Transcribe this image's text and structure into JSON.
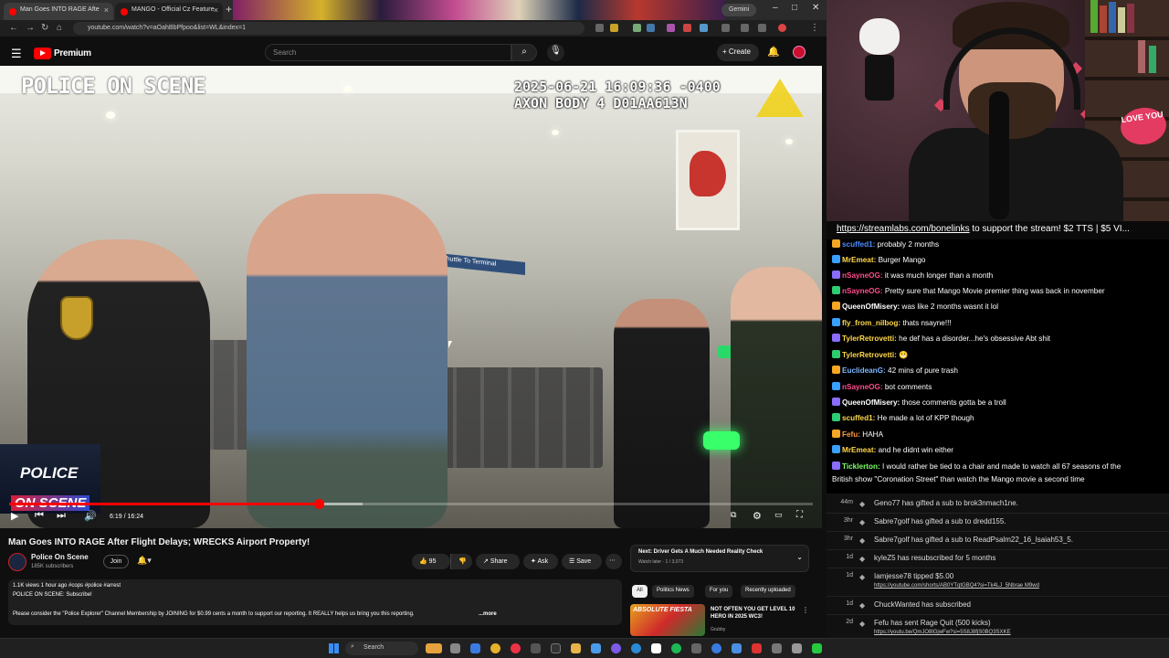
{
  "browser": {
    "tabs": [
      {
        "label": "Man Goes INTO RAGE Afte"
      },
      {
        "label": "MANGO - Official Cz Feature"
      }
    ],
    "gemini_label": "Gemini",
    "url": "youtube.com/watch?v=aOahBbPfpoo&list=WL&index=1"
  },
  "youtube": {
    "logo_text": "Premium",
    "search_placeholder": "Search",
    "create_label": "Create"
  },
  "video": {
    "overlay_title": "POLICE ON SCENE",
    "timestamp_line1": "2025-06-21 16:09:36 -0400",
    "timestamp_line2": "AXON BODY 4 D01AA613N",
    "sign_text": "Shuttle To Terminal",
    "brand_line1": "POLICE",
    "brand_line2": "ON SCENE",
    "time_display": "6:19 / 16:24",
    "progress_fraction": 0.385,
    "buffer_fraction": 0.44
  },
  "info": {
    "title": "Man Goes INTO RAGE After Flight Delays; WRECKS Airport Property!",
    "channel": "Police On Scene",
    "subscribers": "185K subscribers",
    "join_label": "Join",
    "like_count": "95",
    "share_label": "Share",
    "ask_label": "Ask",
    "save_label": "Save",
    "meta": "1.1K views  1 hour ago  #cops #police #arrest",
    "desc_line1": "POLICE ON SCENE: Subscribe!",
    "desc_line2": "Please consider the \"Police Explorer\" Channel Membership by JOINING for $0.99 cents a month to support our reporting. It REALLY helps us bring you this reporting.",
    "more_label": "...more"
  },
  "sidebar": {
    "next_title": "Next: Driver Gets A Much Needed Reality Check",
    "next_sub": "Watch later · 1 / 3,073",
    "chips": [
      "All",
      "Politics News",
      "For you",
      "Recently uploaded"
    ],
    "rec_thumb_text": "ABSOLUTE FIESTA",
    "rec_title": "NOT OFTEN YOU GET LEVEL 10 HERO IN 2025 WC3!",
    "rec_channel": "Grubby"
  },
  "taskbar": {
    "search_label": "Search"
  },
  "stream": {
    "love_sign": "LOVE YOU",
    "banner_link": "https://streamlabs.com/bonelinks",
    "banner_text": " to support the stream! $2 TTS | $5 VI..."
  },
  "chat": [
    {
      "user": "scuffed1:",
      "text": " probably 2 months",
      "color": "#4a8cff"
    },
    {
      "user": "MrEmeat:",
      "text": " Burger Mango",
      "color": "#ffd84a"
    },
    {
      "user": "nSayneOG:",
      "text": " it was much longer than a month",
      "color": "#ff4d8d"
    },
    {
      "user": "nSayneOG:",
      "text": " Pretty sure that Mango Movie premier thing was back in november",
      "color": "#ff4d8d"
    },
    {
      "user": "QueenOfMisery:",
      "text": " was like 2 months wasnt it lol",
      "color": "#ffffff"
    },
    {
      "user": "fly_from_nilbog:",
      "text": " thats nsayne!!!",
      "color": "#ffd84a"
    },
    {
      "user": "TylerRetrovetti:",
      "text": " he def has a disorder...he's obsessive Abt shit",
      "color": "#ffd84a"
    },
    {
      "user": "TylerRetrovetti:",
      "text": " 😬",
      "color": "#ffd84a"
    },
    {
      "user": "EuclideanG:",
      "text": " 42 mins of pure trash",
      "color": "#7fb6ff"
    },
    {
      "user": "nSayneOG:",
      "text": " bot comments",
      "color": "#ff4d8d"
    },
    {
      "user": "QueenOfMisery:",
      "text": " those comments gotta be a troll",
      "color": "#ffffff"
    },
    {
      "user": "scuffed1:",
      "text": " He made a lot of KPP though",
      "color": "#ffd84a"
    },
    {
      "user": "Fefu:",
      "text": " HAHA",
      "color": "#ff9c3d"
    },
    {
      "user": "MrEmeat:",
      "text": " and he didnt win either",
      "color": "#ffd84a"
    },
    {
      "user": "Ticklerton:",
      "text": " I would rather be tied to a chair and made to watch all 67 seasons of the",
      "color": "#7fff6a"
    },
    {
      "user": "",
      "text": "British show \"Coronation Street\" than watch the Mango movie a second time",
      "color": "#ffffff"
    }
  ],
  "events": [
    {
      "time": "44m",
      "text": "Geno77 has gifted a sub to brok3nmach1ne.",
      "sub": ""
    },
    {
      "time": "3hr",
      "text": "Sabre7golf has gifted a sub to dredd155.",
      "sub": ""
    },
    {
      "time": "3hr",
      "text": "Sabre7golf has gifted a sub to ReadPsalm22_16_Isaiah53_5.",
      "sub": ""
    },
    {
      "time": "1d",
      "text": "kyleZ5 has resubscribed for 5 months",
      "sub": ""
    },
    {
      "time": "1d",
      "text": "Iamjesse78 tipped $5.00",
      "sub": "https://youtube.com/shorts/AB0YTqtGBQ4?si=Tk4LJ_5Nbrae M9wd"
    },
    {
      "time": "1d",
      "text": "ChuckWanted has subscribed",
      "sub": ""
    },
    {
      "time": "2d",
      "text": "Fefu has sent Rage Quit (500 kicks)",
      "sub": "https://youtu.be/QmJO8lGjwFw?si=5S8J8fjS0BQ3SXKE"
    }
  ],
  "colors": {
    "youtube_red": "#ff0000",
    "chat_bg": "#000000",
    "events_bg": "#111111"
  }
}
